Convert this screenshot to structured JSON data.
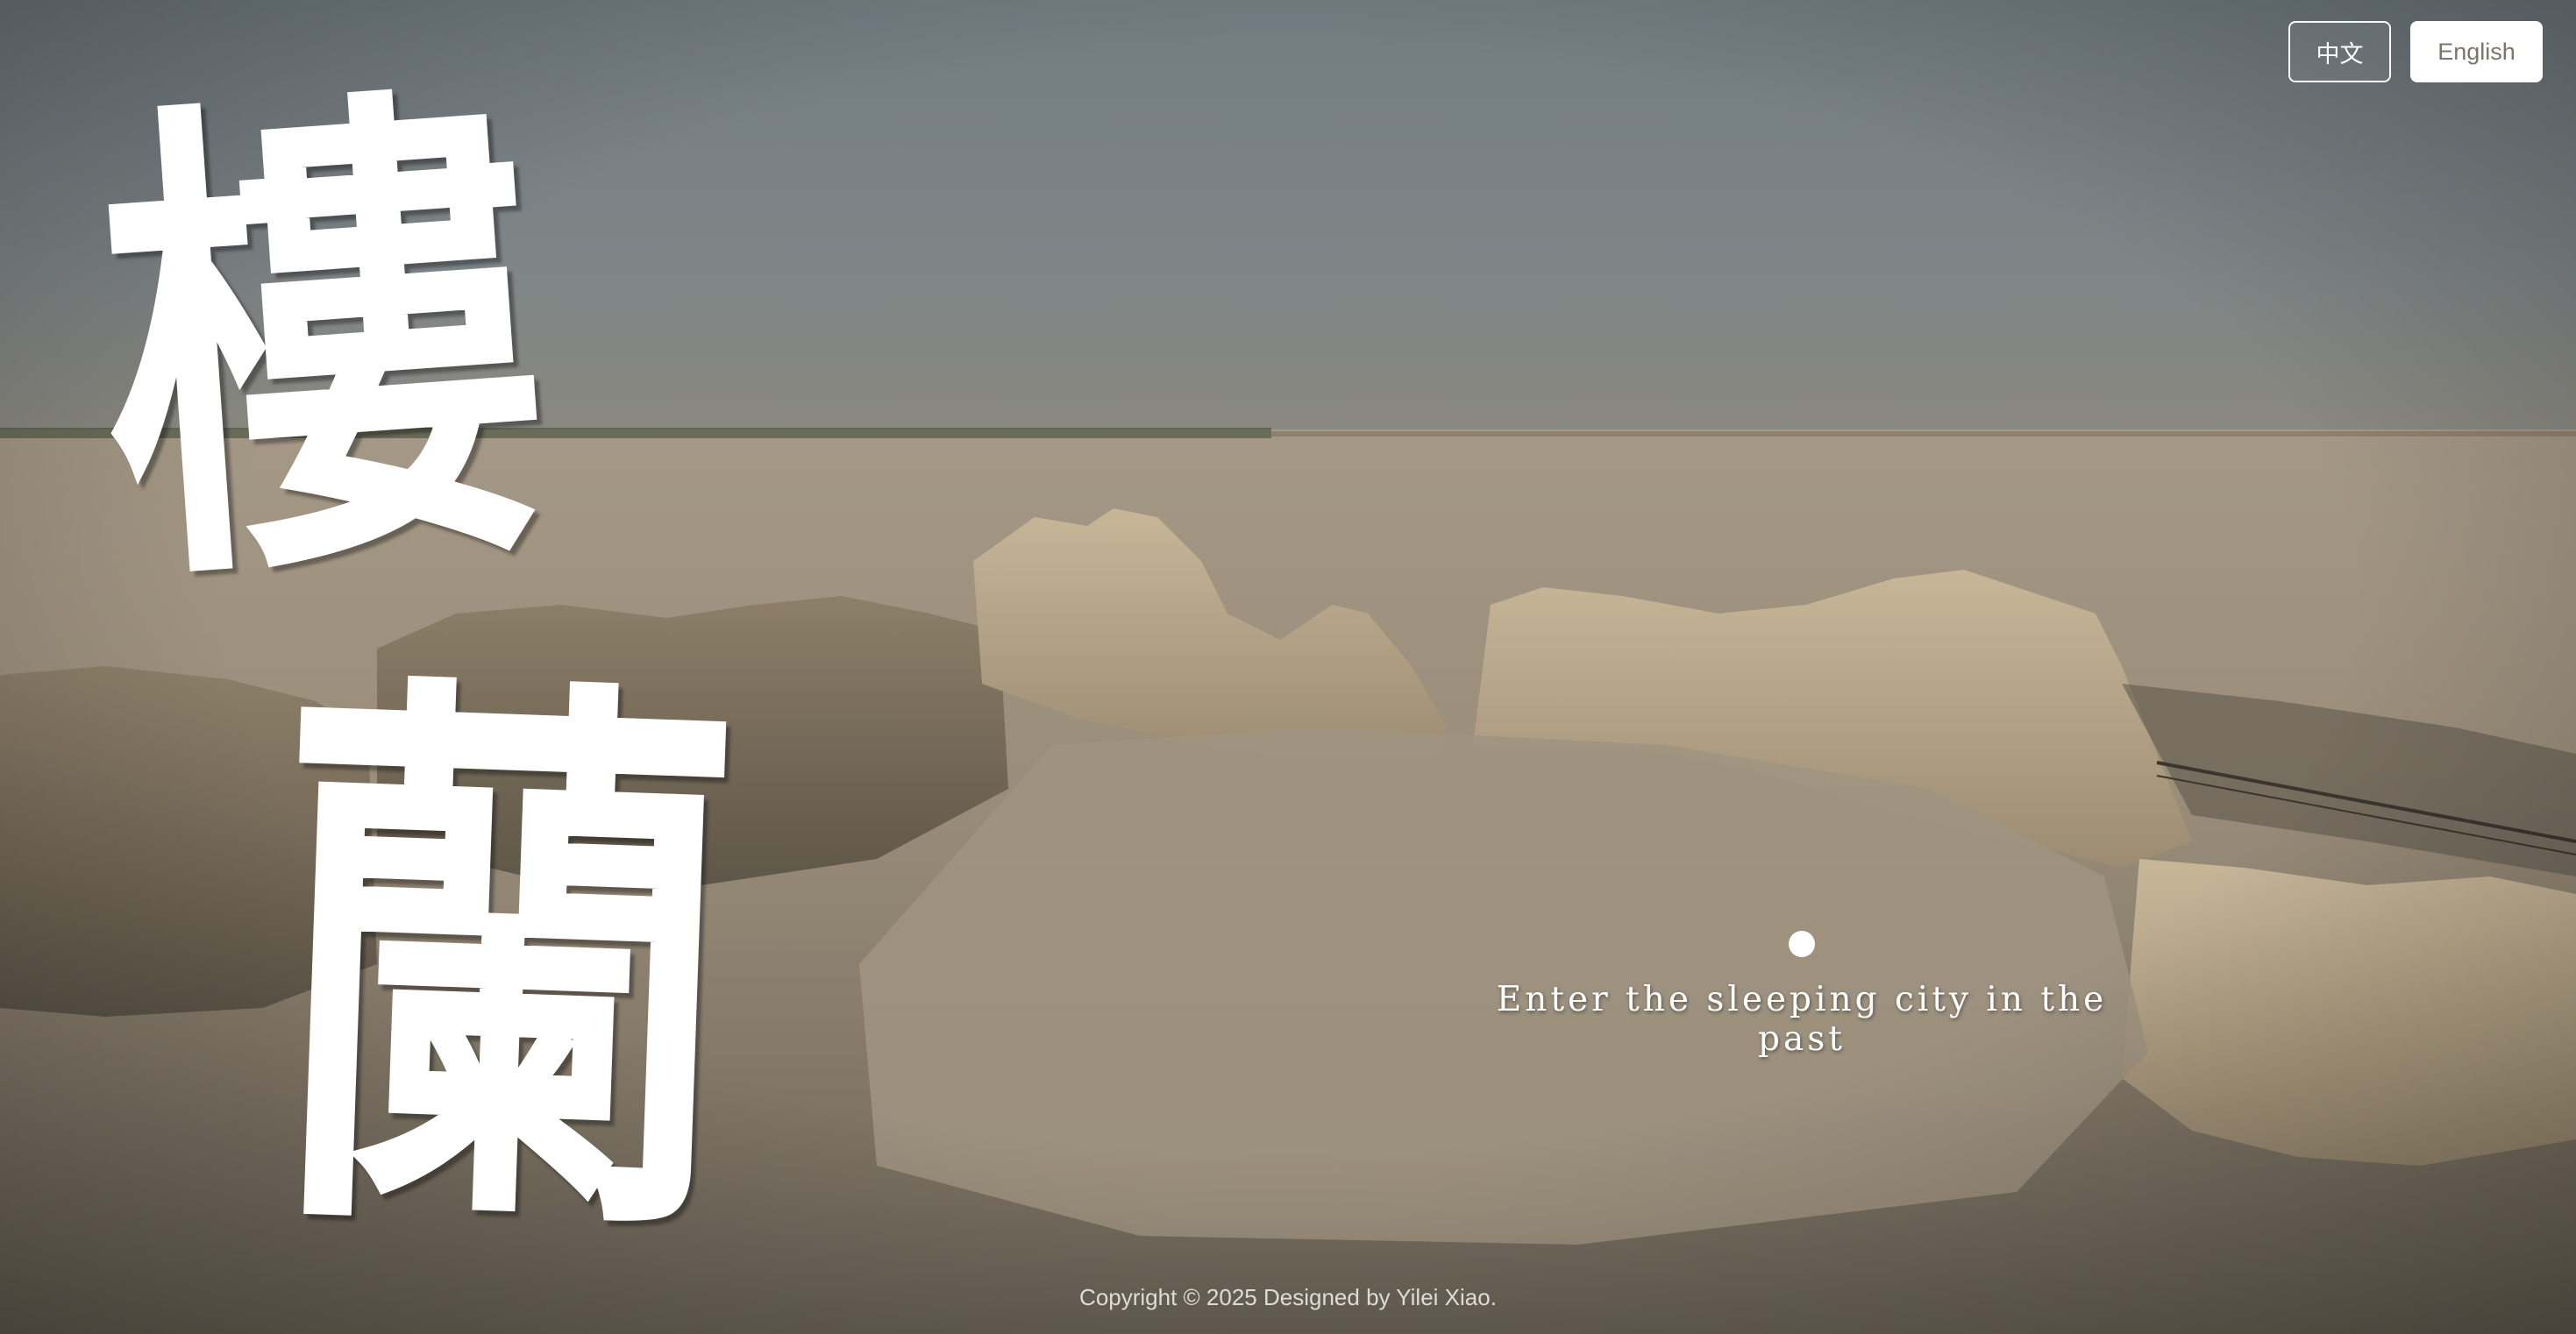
{
  "language_switch": {
    "chinese_label": "中文",
    "english_label": "English"
  },
  "title": {
    "line1": "樓",
    "line2": "蘭"
  },
  "enter": {
    "tagline": "Enter the sleeping city in the past"
  },
  "footer": {
    "copyright": "Copyright © 2025 Designed by Yilei Xiao."
  },
  "colors": {
    "sky": "#7d8488",
    "sand": "#b5a68d",
    "ruins": "#c9b797",
    "text": "#ffffff",
    "english_button_text": "#7b7469"
  }
}
